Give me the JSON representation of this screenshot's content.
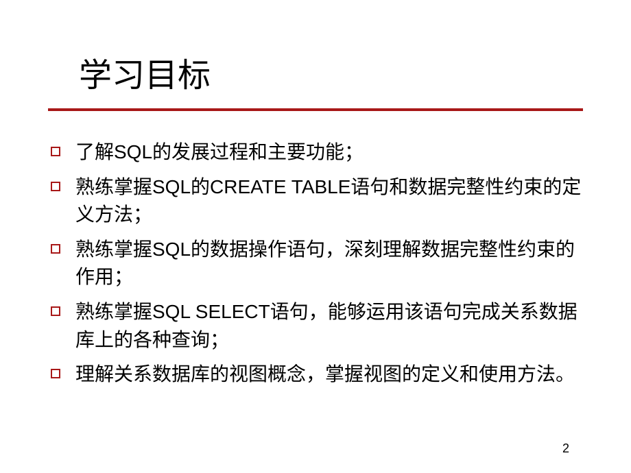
{
  "slide": {
    "title": "学习目标",
    "bullets": [
      "了解SQL的发展过程和主要功能；",
      "熟练掌握SQL的CREATE TABLE语句和数据完整性约束的定义方法；",
      "熟练掌握SQL的数据操作语句，深刻理解数据完整性约束的作用；",
      "熟练掌握SQL SELECT语句，能够运用该语句完成关系数据库上的各种查询；",
      "理解关系数据库的视图概念，掌握视图的定义和使用方法。"
    ],
    "page_number": "2"
  }
}
